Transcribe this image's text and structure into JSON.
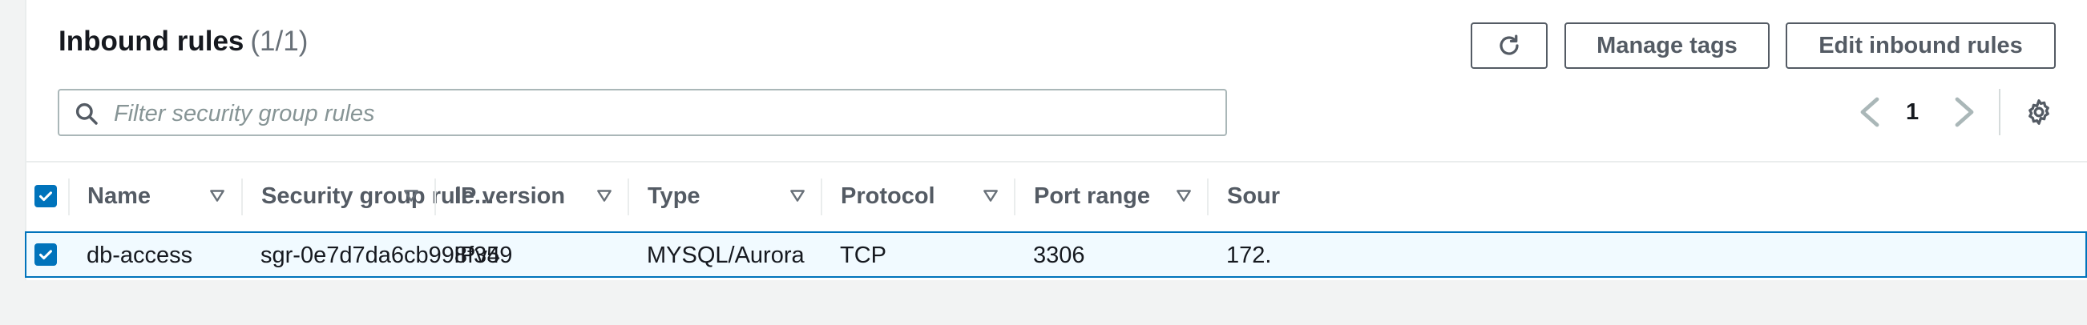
{
  "header": {
    "title": "Inbound rules",
    "count": "(1/1)"
  },
  "buttons": {
    "refresh_icon": "refresh-icon",
    "manage_tags": "Manage tags",
    "edit_inbound_rules": "Edit inbound rules"
  },
  "search": {
    "placeholder": "Filter security group rules",
    "value": ""
  },
  "pagination": {
    "current_page": "1"
  },
  "table": {
    "columns": [
      {
        "label": "Name"
      },
      {
        "label": "Security group rule..."
      },
      {
        "label": "IP version"
      },
      {
        "label": "Type"
      },
      {
        "label": "Protocol"
      },
      {
        "label": "Port range"
      },
      {
        "label": "Sour"
      }
    ],
    "rows": [
      {
        "selected": true,
        "name": "db-access",
        "rule_id": "sgr-0e7d7da6cb998f359",
        "ip_version": "IPv4",
        "type": "MYSQL/Aurora",
        "protocol": "TCP",
        "port_range": "3306",
        "source": "172."
      }
    ]
  },
  "colors": {
    "accent": "#0073bb",
    "selected_row_bg": "#f1faff"
  }
}
